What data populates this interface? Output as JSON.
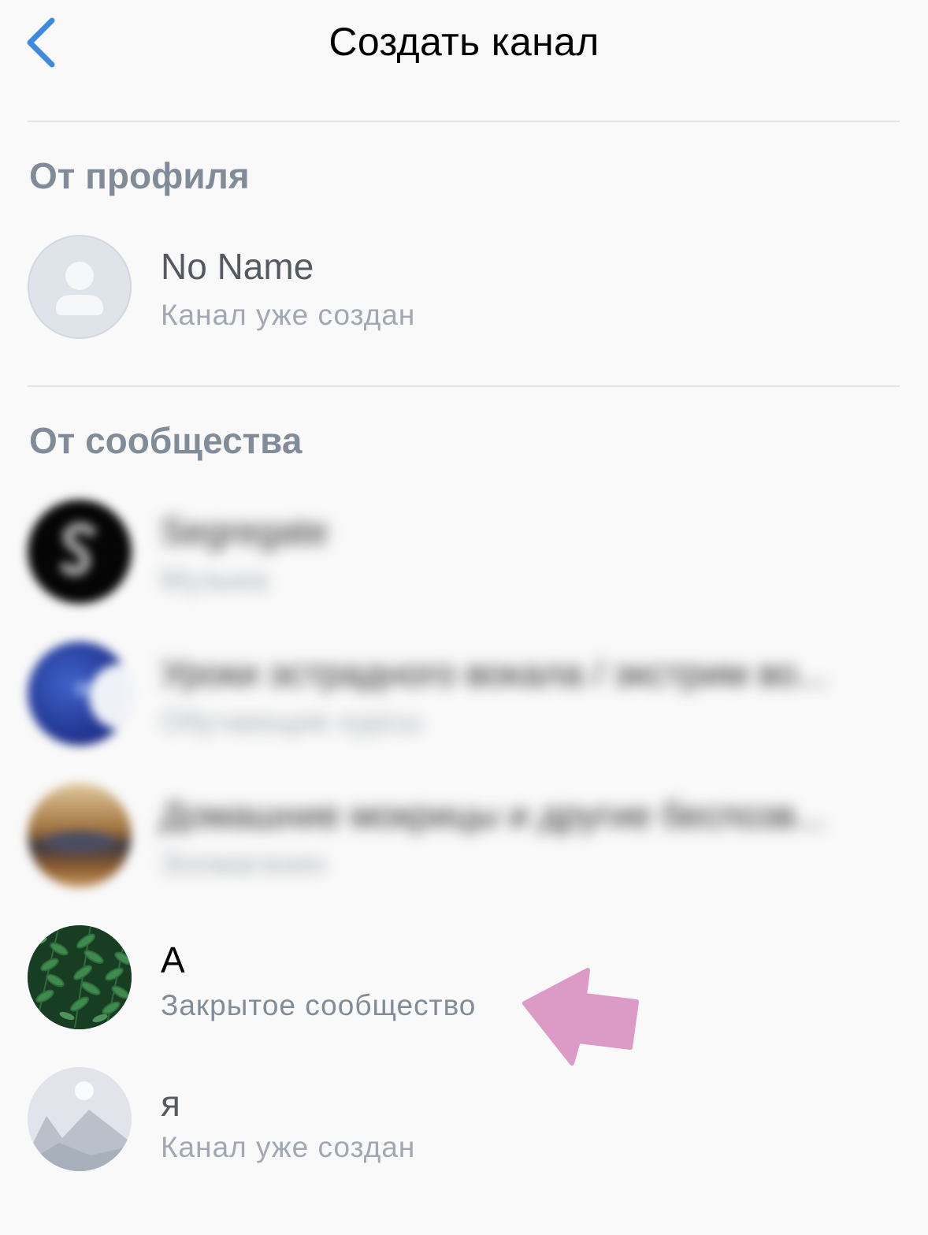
{
  "header": {
    "title": "Создать канал",
    "back_icon": "chevron-left-icon",
    "accent_color": "#3f8ae0"
  },
  "sections": [
    {
      "title": "От профиля",
      "items": [
        {
          "name": "No Name",
          "subtitle": "Канал уже создан",
          "avatar": "user-placeholder-icon"
        }
      ]
    },
    {
      "title": "От сообщества",
      "items": [
        {
          "name": "Segregate",
          "subtitle": "Музыка",
          "avatar": "community-avatar",
          "blurred": true
        },
        {
          "name": "Уроки эстрадного вокала / экстрим во...",
          "subtitle": "Обучающие курсы",
          "avatar": "community-avatar",
          "blurred": true
        },
        {
          "name": "Домашние мокрицы и другие беспозв...",
          "subtitle": "Зоомагазин",
          "avatar": "community-avatar",
          "blurred": true
        },
        {
          "name": "А",
          "subtitle": "Закрытое сообщество",
          "avatar": "leaves-photo",
          "highlighted": true
        },
        {
          "name": "я",
          "subtitle": "Канал уже создан",
          "avatar": "mountain-placeholder-icon"
        }
      ]
    }
  ],
  "annotation": {
    "icon": "pointer-arrow-icon",
    "color": "#dc9ac6"
  },
  "colors": {
    "background": "#f9f9f9",
    "section_header": "#818c99",
    "subtitle": "#a0a8b3",
    "title_disabled": "#555a60",
    "title_active": "#000000"
  }
}
